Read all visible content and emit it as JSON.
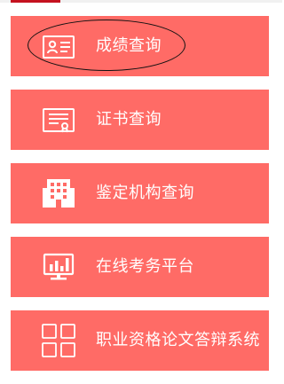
{
  "header": {
    "accent_color": "#c4121f"
  },
  "menu": {
    "item_color": "#ff6b66",
    "items": [
      {
        "label": "成绩查询",
        "icon": "id-card-icon",
        "highlighted": true
      },
      {
        "label": "证书查询",
        "icon": "certificate-icon"
      },
      {
        "label": "鉴定机构查询",
        "icon": "building-icon"
      },
      {
        "label": "在线考务平台",
        "icon": "monitor-chart-icon"
      },
      {
        "label": "职业资格论文答辩系统",
        "icon": "grid-icon"
      }
    ]
  }
}
